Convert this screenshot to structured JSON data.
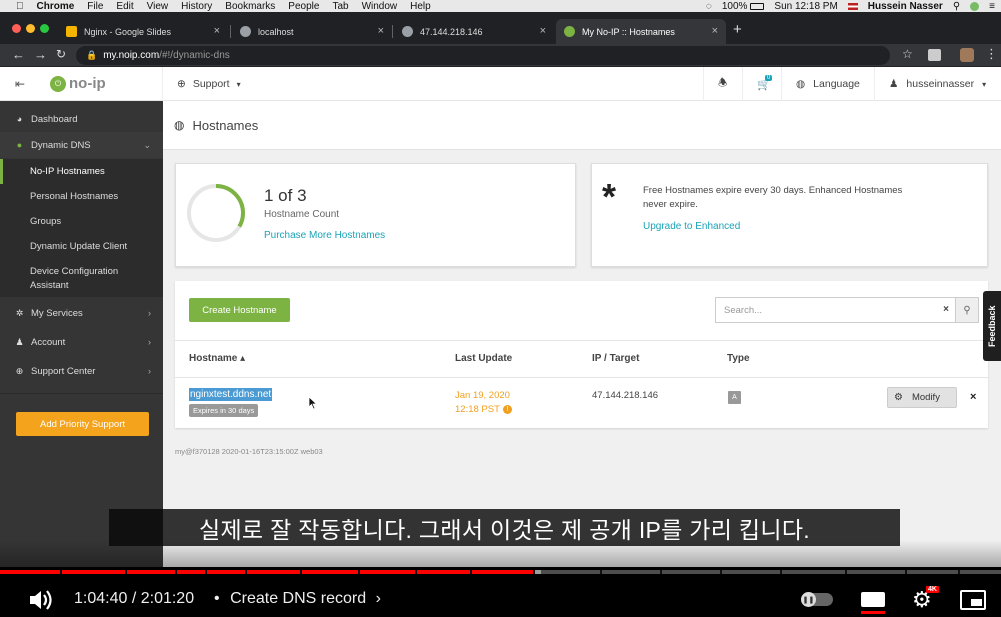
{
  "macos": {
    "menu": [
      "Chrome",
      "File",
      "Edit",
      "View",
      "History",
      "Bookmarks",
      "People",
      "Tab",
      "Window",
      "Help"
    ],
    "battery": "100%",
    "clock": "Sun 12:18 PM",
    "user": "Hussein Nasser"
  },
  "tabs": [
    {
      "label": "Nginx - Google Slides",
      "color": "#f4b400"
    },
    {
      "label": "localhost",
      "color": "#9aa0a6"
    },
    {
      "label": "47.144.218.146",
      "color": "#9aa0a6"
    },
    {
      "label": "My No-IP :: Hostnames",
      "color": "#7cb342"
    }
  ],
  "address": {
    "host": "my.noip.com",
    "path": "/#!/dynamic-dns"
  },
  "header": {
    "logo": "no-ip",
    "support": "Support",
    "cart_count": "0",
    "language": "Language",
    "username": "husseinnasser"
  },
  "sidebar": {
    "items": [
      {
        "label": "Dashboard"
      },
      {
        "label": "Dynamic DNS"
      },
      {
        "label": "No-IP Hostnames"
      },
      {
        "label": "Personal Hostnames"
      },
      {
        "label": "Groups"
      },
      {
        "label": "Dynamic Update Client"
      },
      {
        "label": "Device Configuration"
      },
      {
        "label": "Assistant"
      },
      {
        "label": "My Services"
      },
      {
        "label": "Account"
      },
      {
        "label": "Support Center"
      }
    ],
    "priority": "Add Priority Support"
  },
  "main": {
    "title": "Hostnames",
    "count": "1 of 3",
    "count_fraction": 0.3333,
    "count_label": "Hostname Count",
    "purchase": "Purchase More Hostnames",
    "notice_line1": "Free Hostnames expire every 30 days. Enhanced Hostnames",
    "notice_line2": "never expire.",
    "upgrade": "Upgrade to Enhanced",
    "create": "Create Hostname",
    "search_placeholder": "Search...",
    "columns": [
      "Hostname ▴",
      "Last Update",
      "IP / Target",
      "Type"
    ],
    "row": {
      "hostname": "nginxtest.ddns.net",
      "expires": "Expires in 30 days",
      "date": "Jan 19, 2020",
      "time": "12:18 PST",
      "ip": "47.144.218.146",
      "type": "A",
      "modify": "Modify"
    },
    "footer": "my@f370128 2020-01-16T23:15:00Z web03",
    "feedback": "Feedback"
  },
  "player": {
    "caption": "실제로 잘 작동합니다. 그래서 이것은 제 공개 IP를 가리 킵니다.",
    "time": "1:04:40 / 2:01:20",
    "chapter": "Create DNS record",
    "progress": 0.533,
    "buffered": 0.54,
    "quality_badge": "4K"
  }
}
